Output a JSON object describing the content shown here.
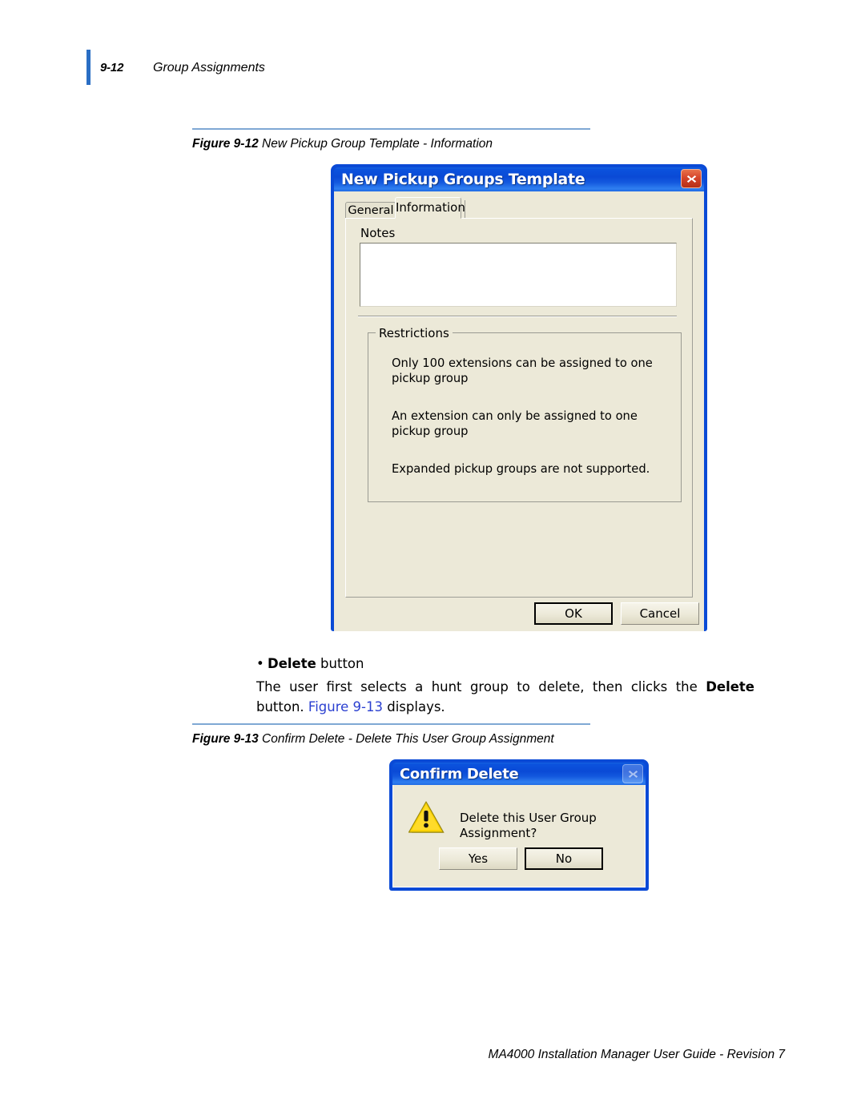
{
  "page": {
    "header": {
      "page_number": "9-12",
      "section_title": "Group Assignments"
    },
    "footer": {
      "text": "MA4000 Installation Manager User Guide - Revision 7"
    }
  },
  "figure_912": {
    "caption_number": "Figure 9-12",
    "caption_text": "New Pickup Group Template - Information"
  },
  "figure_913": {
    "caption_number": "Figure 9-13",
    "caption_text": "Confirm Delete - Delete This User Group Assignment"
  },
  "body": {
    "bullet_bold": "Delete",
    "bullet_rest": " button",
    "paragraph_part1": "The user first selects a hunt group to delete, then clicks the ",
    "paragraph_bold": "Delete",
    "paragraph_part2": " button. ",
    "paragraph_xref": "Figure 9-13",
    "paragraph_part3": " displays."
  },
  "dialog_pickup": {
    "title": "New Pickup Groups Template",
    "close_icon": "close-icon",
    "tabs": [
      {
        "label": "General",
        "active": false
      },
      {
        "label": "Information",
        "active": true
      }
    ],
    "notes": {
      "label": "Notes",
      "value": "",
      "placeholder": ""
    },
    "restrictions": {
      "legend": "Restrictions",
      "items": [
        "Only 100 extensions can be assigned to one pickup group",
        "An extension can only be assigned to one pickup group",
        "Expanded pickup groups are not supported."
      ]
    },
    "buttons": {
      "ok": "OK",
      "cancel": "Cancel"
    }
  },
  "dialog_confirm": {
    "title": "Confirm Delete",
    "close_icon": "close-icon",
    "warning_icon": "warning-triangle-icon",
    "message": "Delete this User Group Assignment?",
    "buttons": {
      "yes": "Yes",
      "no": "No"
    }
  },
  "colors": {
    "titlebar_blue": "#0a4ad6",
    "dialog_face": "#ece9d8",
    "close_red": "#d6452b",
    "rule_blue": "#7fa8d4",
    "xref_blue": "#2a3fd0",
    "header_bar_blue": "#2a6ec4",
    "warning_yellow": "#f5d10a"
  }
}
